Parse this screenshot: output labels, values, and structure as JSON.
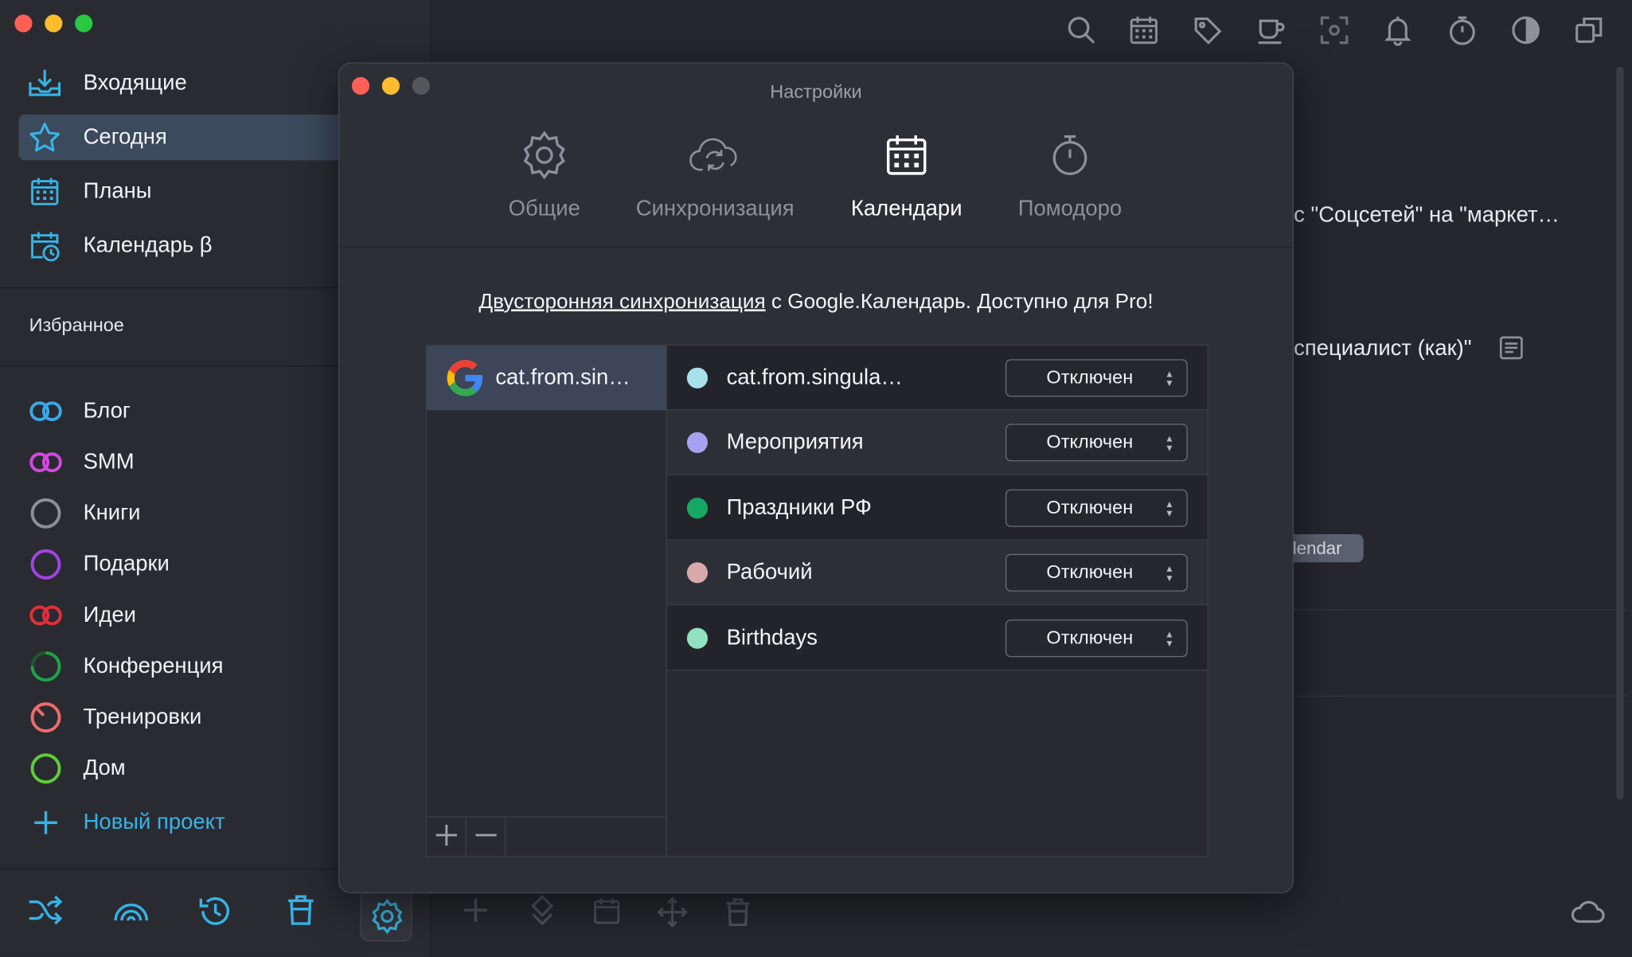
{
  "window": {
    "title": ""
  },
  "sidebar": {
    "nav": [
      {
        "label": "Входящие",
        "icon": "inbox-icon"
      },
      {
        "label": "Сегодня",
        "icon": "star-icon"
      },
      {
        "label": "Планы",
        "icon": "calendar-grid-icon"
      },
      {
        "label": "Календарь β",
        "icon": "calendar-clock-icon"
      }
    ],
    "favorites_heading": "Избранное",
    "projects": [
      {
        "label": "Блог",
        "color": "#3aa8e8"
      },
      {
        "label": "SMM",
        "color": "#d448e0"
      },
      {
        "label": "Книги",
        "color": "#8b8f98"
      },
      {
        "label": "Подарки",
        "color": "#a243e3"
      },
      {
        "label": "Идеи",
        "color": "#e0303a"
      },
      {
        "label": "Конференция",
        "color": "#1fa34a"
      },
      {
        "label": "Тренировки",
        "color": "#f06a6a"
      },
      {
        "label": "Дом",
        "color": "#5ccd3a"
      }
    ],
    "new_project": "Новый проект",
    "accent": "#37b3e6"
  },
  "background": {
    "text1": "с \"Соцсетей\" на \"маркет…",
    "text2": "специалист (как)\"",
    "badge": "lendar"
  },
  "dialog": {
    "title": "Настройки",
    "tabs": [
      {
        "label": "Общие",
        "icon": "gear-icon"
      },
      {
        "label": "Синхронизация",
        "icon": "cloud-sync-icon"
      },
      {
        "label": "Календари",
        "icon": "calendar-icon",
        "active": true
      },
      {
        "label": "Помодоро",
        "icon": "stopwatch-icon"
      }
    ],
    "promo_link": "Двусторонняя синхронизация",
    "promo_rest": " с Google.Календарь. Доступно для Pro!",
    "account": "cat.from.sin…",
    "add": "+",
    "remove": "−",
    "calendars": [
      {
        "name": "cat.from.singula…",
        "color": "#a8e0ec",
        "status": "Отключен"
      },
      {
        "name": "Мероприятия",
        "color": "#a6a2f2",
        "status": "Отключен"
      },
      {
        "name": "Праздники РФ",
        "color": "#16a765",
        "status": "Отключен"
      },
      {
        "name": "Рабочий",
        "color": "#d7a9ab",
        "status": "Отключен"
      },
      {
        "name": "Birthdays",
        "color": "#92e1c0",
        "status": "Отключен"
      }
    ]
  }
}
